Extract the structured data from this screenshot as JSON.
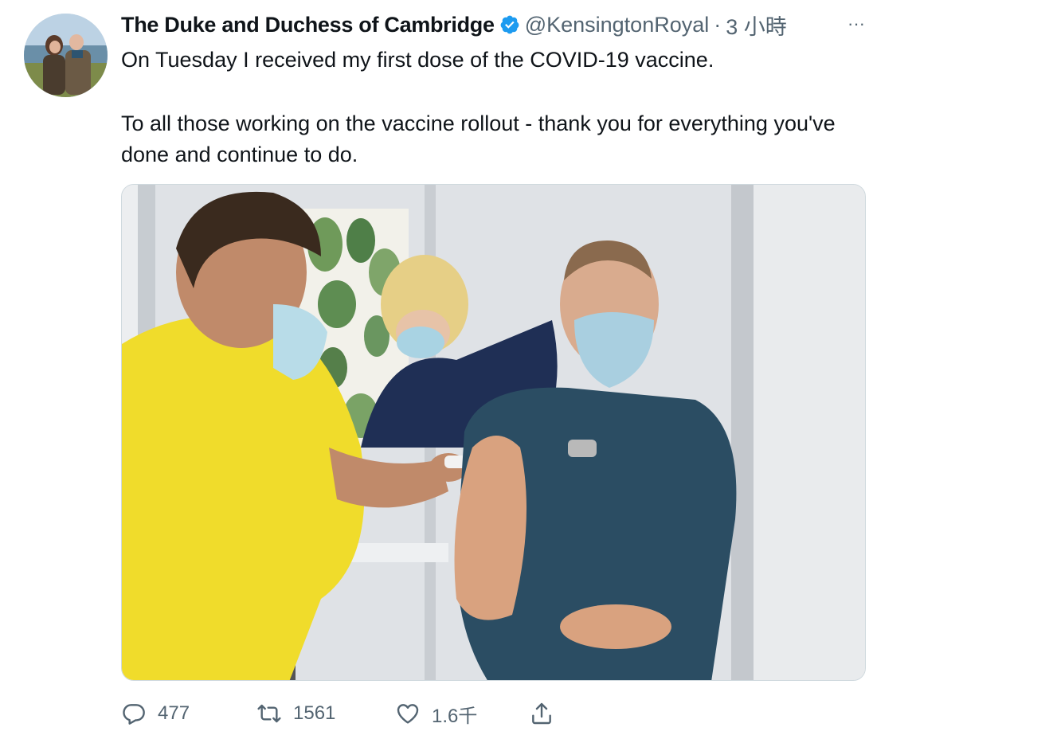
{
  "tweet": {
    "author_name": "The Duke and Duchess of Cambridge",
    "author_handle": "@KensingtonRoyal",
    "separator": "·",
    "timestamp": "3 小時",
    "more_label": "···",
    "text_paragraphs": [
      "On Tuesday I received my first dose of the COVID-19 vaccine.",
      "To all those working on the vaccine rollout - thank you for everything you've done and continue to do."
    ]
  },
  "actions": {
    "reply_count": "477",
    "retweet_count": "1561",
    "like_count": "1.6千"
  },
  "icons": {
    "verified": "verified-badge-icon",
    "more": "more-icon",
    "reply": "reply-icon",
    "retweet": "retweet-icon",
    "like": "heart-icon",
    "share": "share-icon"
  },
  "colors": {
    "verified_blue": "#1d9bf0",
    "secondary_text": "#536471",
    "primary_text": "#0f1419"
  }
}
